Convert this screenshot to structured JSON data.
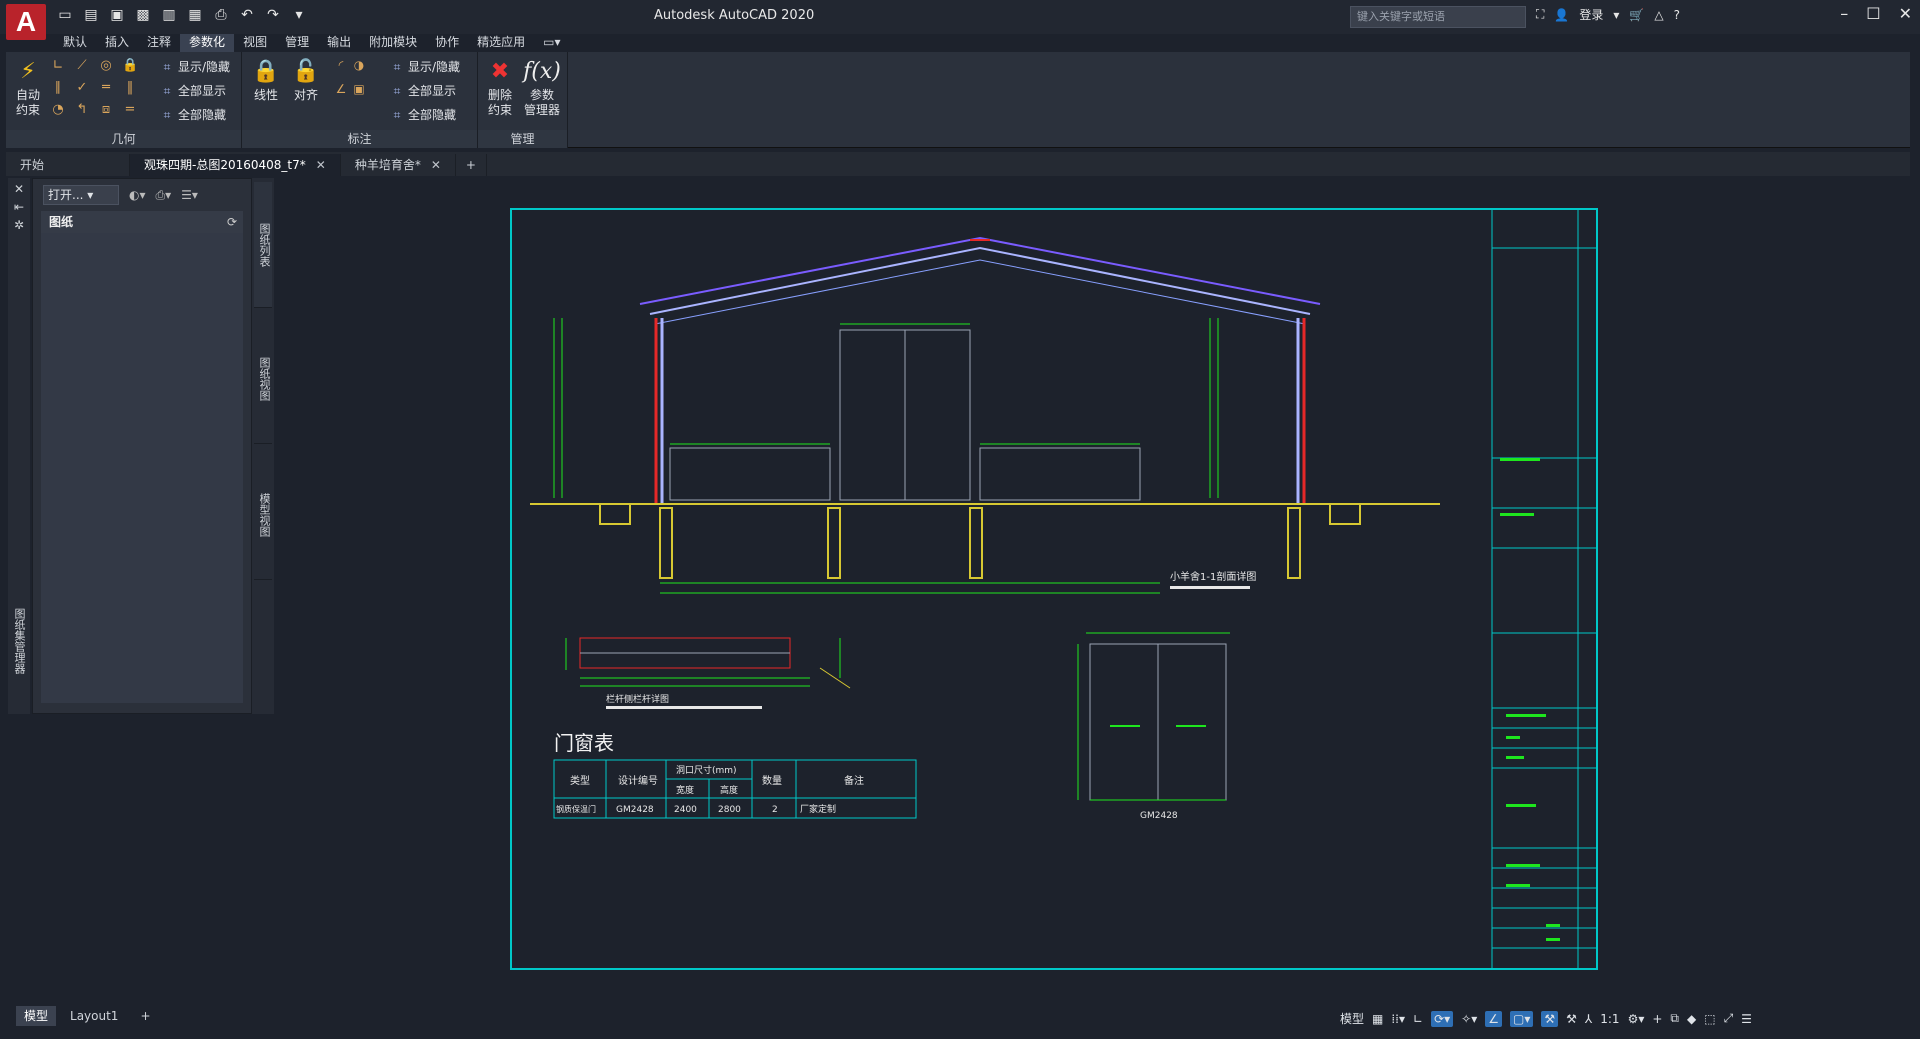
{
  "app": {
    "title": "Autodesk AutoCAD 2020",
    "logo_letter": "A"
  },
  "search": {
    "placeholder": "键入关键字或短语"
  },
  "account": {
    "login": "登录"
  },
  "menu": [
    "默认",
    "插入",
    "注释",
    "参数化",
    "视图",
    "管理",
    "输出",
    "附加模块",
    "协作",
    "精选应用"
  ],
  "menu_active": "参数化",
  "ribbon": {
    "geometry": {
      "title": "几何",
      "auto_constrain": [
        "自动",
        "约束"
      ],
      "show_hide": "显示/隐藏",
      "show_all": "全部显示",
      "hide_all": "全部隐藏"
    },
    "dimension": {
      "title": "标注",
      "linear": "线性",
      "aligned": "对齐",
      "show_hide": "显示/隐藏",
      "show_all": "全部显示",
      "hide_all": "全部隐藏"
    },
    "manage": {
      "title": "管理",
      "delete_constraints": [
        "删除",
        "约束"
      ],
      "param_manager": [
        "参数",
        "管理器"
      ],
      "fx": "f(x)"
    }
  },
  "tabs": [
    {
      "label": "开始",
      "closable": false
    },
    {
      "label": "观珠四期-总图20160408_t7*",
      "closable": true,
      "active": true
    },
    {
      "label": "种羊培育舍*",
      "closable": true
    }
  ],
  "sheet_panel": {
    "open_dropdown": "打开...",
    "header": "图纸",
    "side_label": "图纸集管理器"
  },
  "vertical_tabs": [
    "图纸列表",
    "图纸视图",
    "模型视图"
  ],
  "drawing": {
    "door_window_table_title": "门窗表",
    "table_headers": [
      "类型",
      "设计编号",
      "洞口尺寸(mm)",
      "数量",
      "备注"
    ],
    "table_subheaders": [
      "宽度",
      "高度"
    ],
    "table_row": [
      "钢质保温门",
      "GM2428",
      "2400",
      "2800",
      "2",
      "厂家定制"
    ],
    "section_title": "小羊舍1-1剖面详图",
    "detail_title": "栏杆侧栏杆详图",
    "door_label": "GM2428"
  },
  "model_tabs": [
    "模型",
    "Layout1"
  ],
  "status": {
    "model": "模型",
    "scale": "1:1"
  },
  "colors": {
    "bg": "#1d222c",
    "frame": "#00c8c8",
    "green": "#1ee61e",
    "yellow": "#d7c832",
    "red": "#e62828"
  }
}
